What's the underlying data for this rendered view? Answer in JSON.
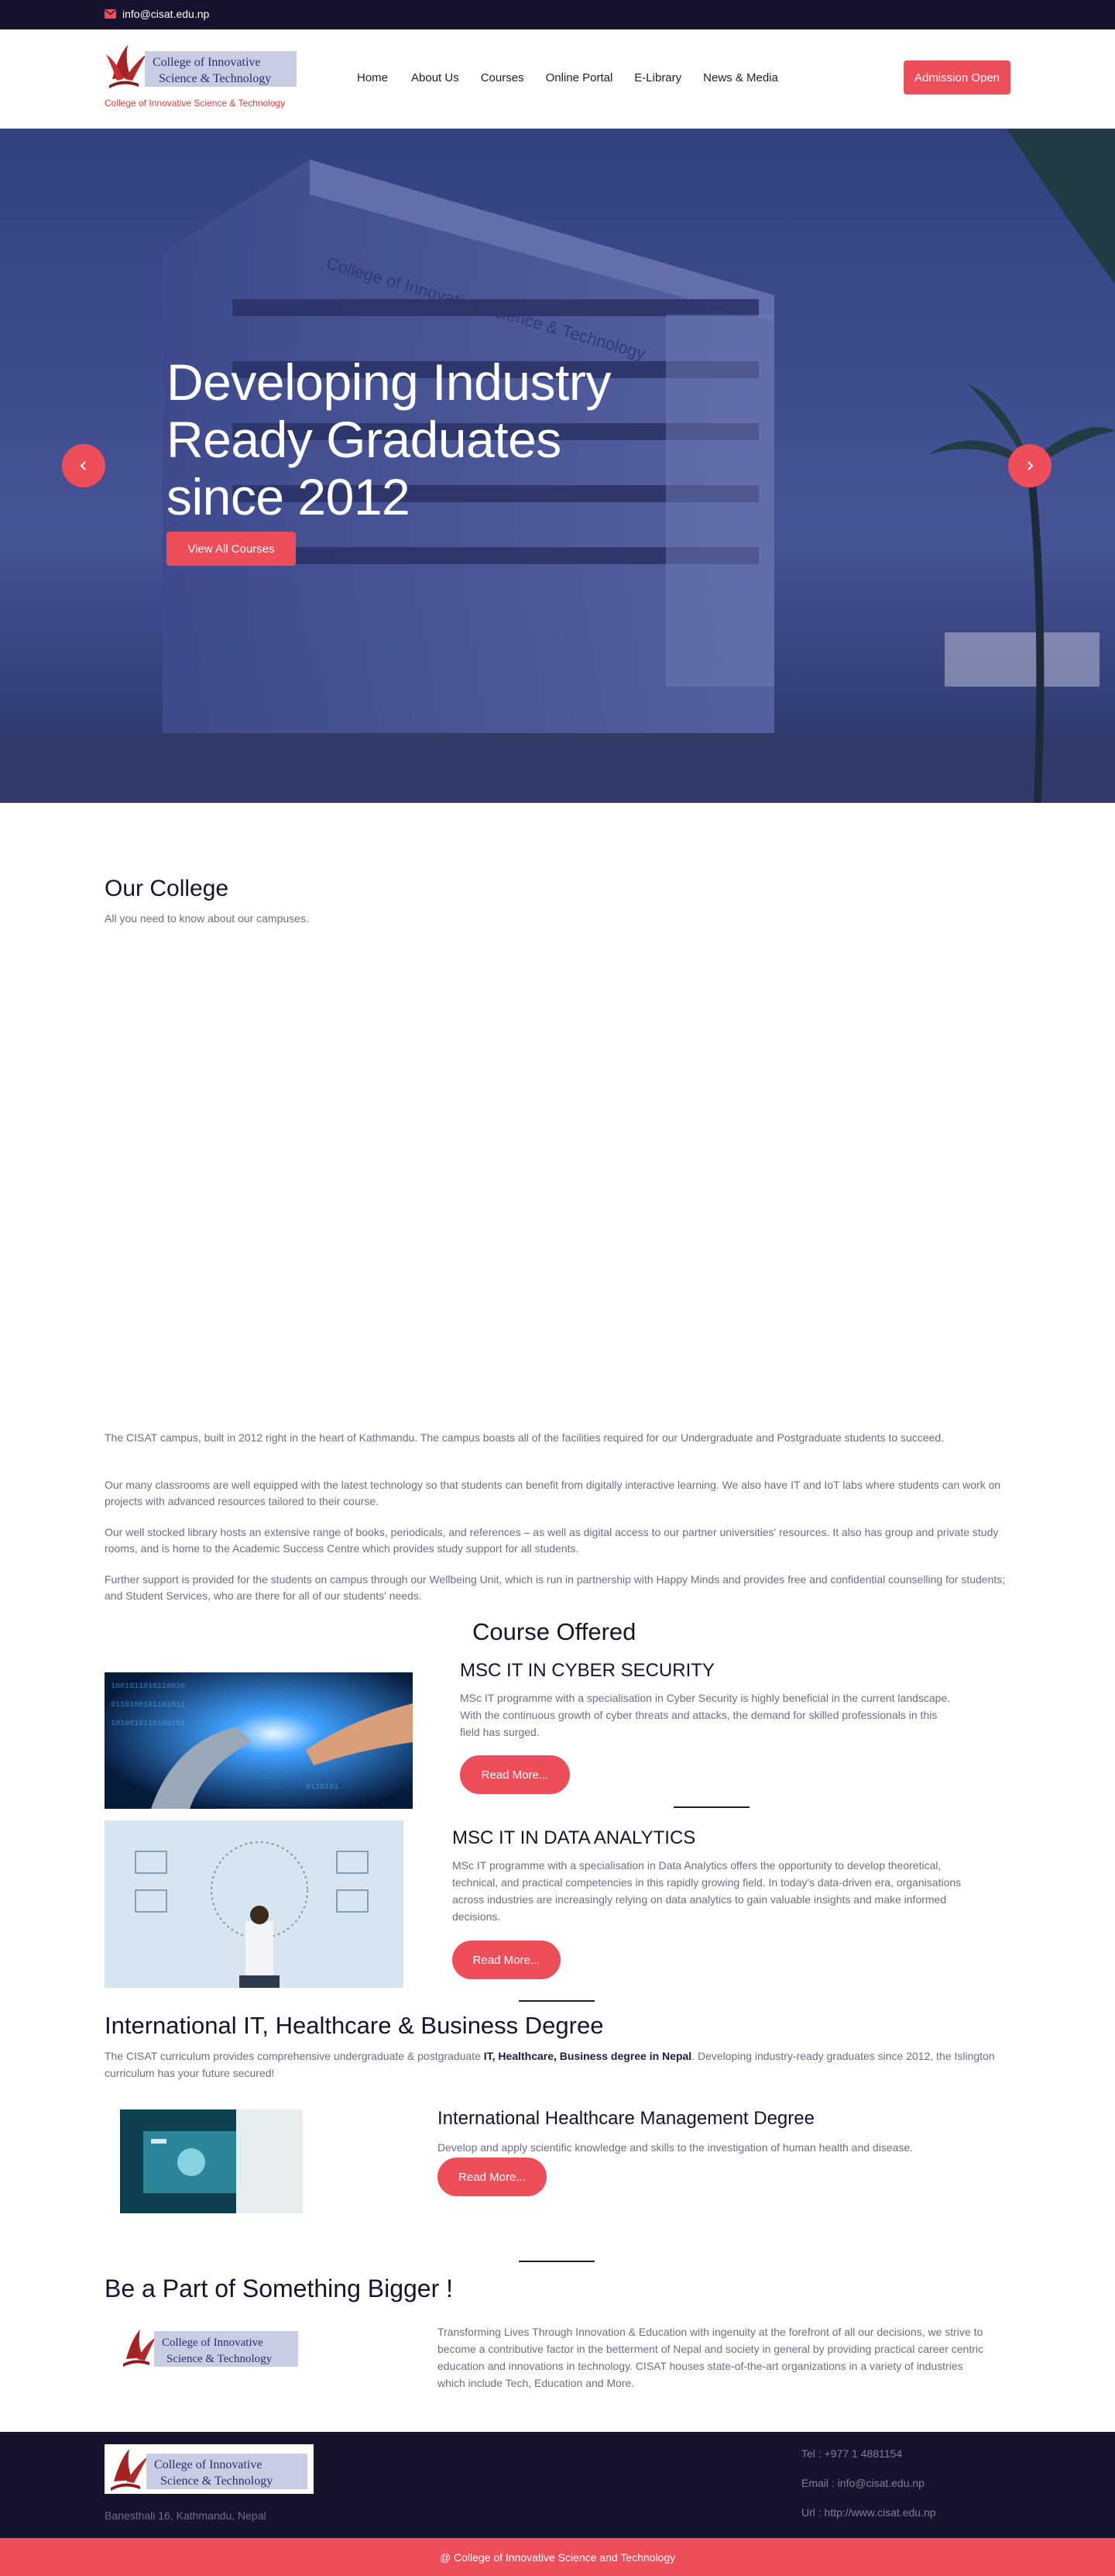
{
  "topbar": {
    "email": "info@cisat.edu.np"
  },
  "brand": {
    "logo_line1": "College of Innovative",
    "logo_line2": "Science & Technology",
    "tagline": "College of Innovative Science & Technology"
  },
  "nav": {
    "items": [
      "Home",
      "About Us",
      "Courses",
      "Online Portal",
      "E-Library",
      "News & Media"
    ],
    "cta": "Admission Open"
  },
  "hero": {
    "title": "Developing Industry Ready Graduates since 2012",
    "button": "View All Courses",
    "building_sign": "College of Innovative Science & Technology"
  },
  "college": {
    "title": "Our College",
    "subtitle": "All you need to know about our campuses.",
    "paragraphs": [
      "The CISAT campus, built in 2012 right in the heart of Kathmandu. The campus boasts all of the facilities required for our Undergraduate and Postgraduate students to succeed.",
      "Our many classrooms are well equipped with the latest technology so that students can benefit from digitally interactive learning. We also have IT and IoT labs where students can work on projects with advanced resources tailored to their course.",
      "Our well stocked library hosts an extensive range of books, periodicals, and references – as well as digital access to our partner universities' resources. It also has group and private study rooms, and is home to the Academic Success Centre which provides study support for all students.",
      "Further support is provided for the students on campus through our Wellbeing Unit, which is run in partnership with Happy Minds and provides free and confidential counselling for students; and Student Services, who are there for all of our students' needs."
    ]
  },
  "courses": {
    "title": "Course Offered",
    "items": [
      {
        "title": "MSC IT IN CYBER SECURITY",
        "desc": "MSc IT programme with a specialisation in Cyber Security is highly beneficial in the current landscape. With the continuous growth of cyber threats and attacks, the demand for skilled professionals in this field has surged.",
        "button": "Read More..."
      },
      {
        "title": "MSC IT IN DATA ANALYTICS",
        "desc": "MSc IT programme with a specialisation in Data Analytics offers the opportunity to develop theoretical, technical, and practical competencies in this rapidly growing field. In today's data-driven era, organisations across industries are increasingly relying on data analytics to gain valuable insights and make informed decisions.",
        "button": "Read More..."
      }
    ]
  },
  "international": {
    "title": "International IT, Healthcare & Business Degree",
    "desc_before": "The CISAT curriculum provides comprehensive undergraduate & postgraduate ",
    "desc_bold": "IT, Healthcare, Business degree in Nepal",
    "desc_after": ". Developing industry-ready graduates since 2012, the Islington curriculum has your future secured!",
    "course": {
      "title": "International Healthcare Management Degree",
      "desc": "Develop and apply scientific knowledge and skills to the investigation of human health and disease.",
      "button": "Read More..."
    }
  },
  "bigger": {
    "title": "Be a Part of Something Bigger !",
    "desc": "Transforming Lives Through Innovation & Education with ingenuity at the forefront of all our decisions, we strive to become a contributive factor in the betterment of Nepal and society in general by providing practical career centric education and innovations in technology. CISAT houses state-of-the-art organizations in a variety of industries which include Tech, Education and More."
  },
  "footer": {
    "address": "Banesthali 16, Kathmandu, Nepal",
    "tel": "Tel : +977 1 4881154",
    "email": "Email : info@cisat.edu.np",
    "url": "Url : http://www.cisat.edu.np",
    "copyright": "@ College of Innovative Science and Technology"
  },
  "colors": {
    "accent": "#ee4d5a",
    "dark": "#16132e",
    "text": "#6c6f80"
  },
  "icons": [
    "mail-icon",
    "chevron-left-icon",
    "chevron-right-icon",
    "book-logo-icon"
  ]
}
